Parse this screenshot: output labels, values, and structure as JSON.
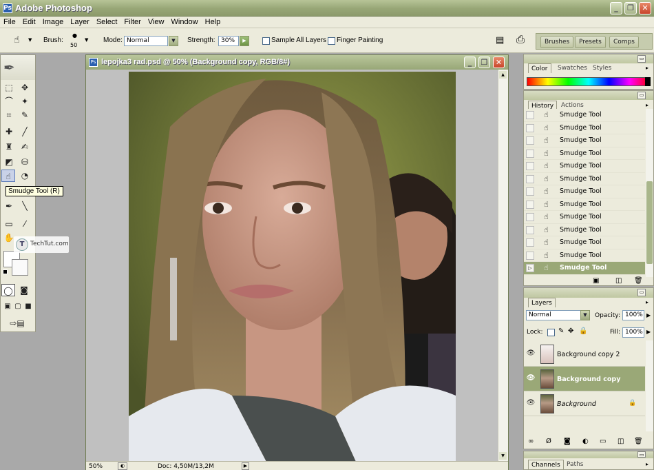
{
  "app": {
    "title": "Adobe Photoshop"
  },
  "window_controls": {
    "minimize": "_",
    "maximize": "❐",
    "close": "✕"
  },
  "menu": [
    "File",
    "Edit",
    "Image",
    "Layer",
    "Select",
    "Filter",
    "View",
    "Window",
    "Help"
  ],
  "options": {
    "brush_label": "Brush:",
    "brush_size": "50",
    "mode_label": "Mode:",
    "mode_value": "Normal",
    "strength_label": "Strength:",
    "strength_value": "30%",
    "sample_all_layers": "Sample All Layers",
    "finger_painting": "Finger Painting",
    "well_tabs": [
      "Brushes",
      "Presets",
      "Comps"
    ]
  },
  "tooltip": "Smudge Tool (R)",
  "watermark": {
    "logo": "T",
    "text": "TechTut.com"
  },
  "document": {
    "title": "lepojka3 rad.psd @ 50% (Background copy, RGB/8#)",
    "zoom": "50%",
    "doc_size": "Doc: 4,50M/13,2M"
  },
  "color_panel": {
    "tabs": [
      "Color",
      "Swatches",
      "Styles"
    ]
  },
  "history_panel": {
    "tabs": [
      "History",
      "Actions"
    ],
    "items": [
      "Smudge Tool",
      "Smudge Tool",
      "Smudge Tool",
      "Smudge Tool",
      "Smudge Tool",
      "Smudge Tool",
      "Smudge Tool",
      "Smudge Tool",
      "Smudge Tool",
      "Smudge Tool",
      "Smudge Tool",
      "Smudge Tool",
      "Smudge Tool"
    ]
  },
  "layers_panel": {
    "tab": "Layers",
    "blend_mode": "Normal",
    "opacity_label": "Opacity:",
    "opacity_value": "100%",
    "lock_label": "Lock:",
    "fill_label": "Fill:",
    "fill_value": "100%",
    "layers": [
      "Background copy 2",
      "Background copy",
      "Background"
    ]
  },
  "channels_panel": {
    "tabs": [
      "Channels",
      "Paths"
    ]
  },
  "colors": {
    "title_bar": "#97a676",
    "selection": "#9aa877",
    "panel_bg": "#ecebdc"
  }
}
